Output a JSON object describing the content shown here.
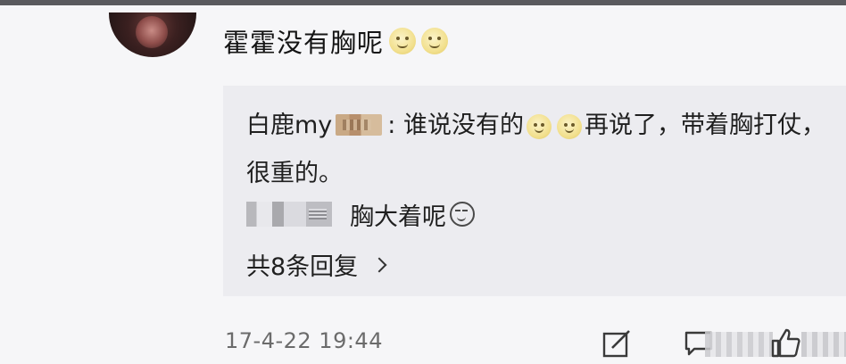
{
  "comment": {
    "text": "霍霍没有胸呢",
    "emojis": [
      "smile-emoji",
      "smile-emoji"
    ]
  },
  "replies": {
    "reply1": {
      "author": "白鹿my",
      "separator": ":",
      "text_part1": "谁说没有的",
      "text_part2": "再说了，带着胸打仗，很重的。"
    },
    "reply2": {
      "text": "胸大着呢"
    },
    "more_label": "共8条回复"
  },
  "footer": {
    "timestamp": "17-4-22 19:44"
  },
  "colors": {
    "background": "#f6f6f8",
    "reply_panel": "#ececf0",
    "text": "#1f1f1f",
    "muted": "#6b6b6b"
  }
}
